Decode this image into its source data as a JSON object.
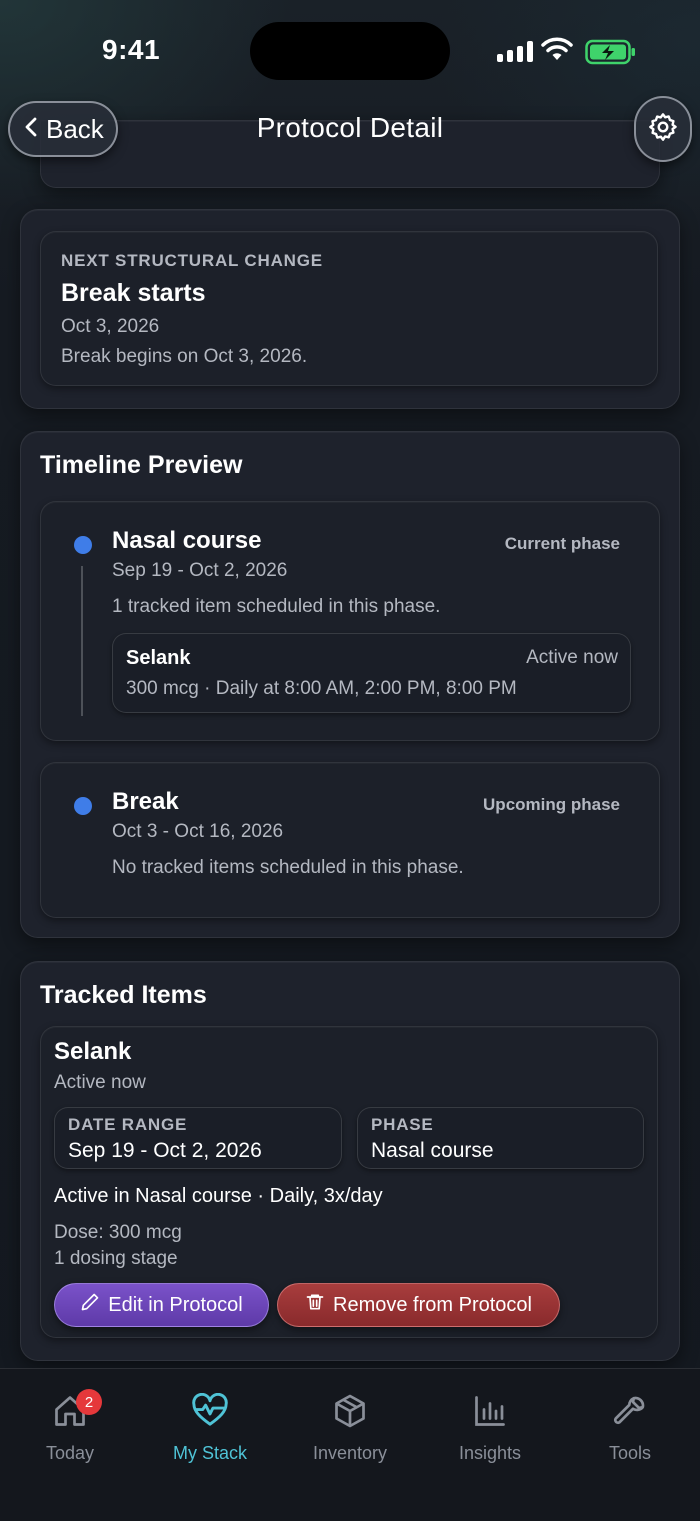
{
  "status": {
    "time": "9:41"
  },
  "nav": {
    "back_label": "Back",
    "title": "Protocol Detail"
  },
  "next_change": {
    "label": "NEXT STRUCTURAL CHANGE",
    "title": "Break starts",
    "date": "Oct 3, 2026",
    "description": "Break begins on Oct 3, 2026."
  },
  "timeline": {
    "title": "Timeline Preview",
    "phases": [
      {
        "name": "Nasal course",
        "status": "Current phase",
        "dates": "Sep 19 - Oct 2, 2026",
        "summary": "1 tracked item scheduled in this phase.",
        "item": {
          "name": "Selank",
          "status": "Active now",
          "detail": "300 mcg · Daily at 8:00 AM, 2:00 PM, 8:00 PM"
        }
      },
      {
        "name": "Break",
        "status": "Upcoming phase",
        "dates": "Oct 3 - Oct 16, 2026",
        "summary": "No tracked items scheduled in this phase."
      }
    ]
  },
  "tracked": {
    "title": "Tracked Items",
    "item": {
      "name": "Selank",
      "status": "Active now",
      "date_range_label": "DATE RANGE",
      "date_range": "Sep 19 - Oct 2, 2026",
      "phase_label": "PHASE",
      "phase": "Nasal course",
      "schedule": "Active in Nasal course · Daily, 3x/day",
      "dose": "Dose: 300 mcg",
      "stages": "1 dosing stage",
      "edit_label": "Edit in Protocol",
      "remove_label": "Remove from Protocol"
    }
  },
  "tabs": [
    {
      "label": "Today",
      "icon": "home-icon",
      "badge": "2"
    },
    {
      "label": "My Stack",
      "icon": "heart-pulse-icon"
    },
    {
      "label": "Inventory",
      "icon": "box-icon"
    },
    {
      "label": "Insights",
      "icon": "bar-chart-icon"
    },
    {
      "label": "Tools",
      "icon": "wrench-icon"
    }
  ],
  "colors": {
    "accent": "#4fc3d6",
    "dot": "#3f7de8",
    "edit": "#6b46b8",
    "remove": "#9a3335",
    "badge": "#e5383b"
  }
}
